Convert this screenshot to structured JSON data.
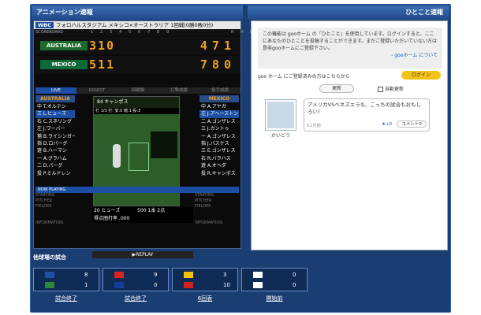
{
  "headers": {
    "animation": "アニメーション速報",
    "hitokoto": "ひとこと速報"
  },
  "game": {
    "tag": "WBC",
    "venue": "フォロハルスタジアム メキシコ×オーストラリア 1回戦(0勝0敗0分)",
    "score_header": [
      "SCOREBOARD",
      "1",
      "2",
      "3",
      "4",
      "5",
      "6",
      "7",
      "8",
      "9",
      "R",
      "H",
      "E"
    ],
    "away": {
      "name": "AUSTRALIA",
      "innings": "310",
      "rhe": "471"
    },
    "home": {
      "name": "MEXICO",
      "innings": "511",
      "rhe": "780"
    }
  },
  "tabs": [
    "LIVE",
    "DIGEST",
    "回顧録",
    "打撃成績",
    "投手成績"
  ],
  "left_team": {
    "name": "AUSTRALIA",
    "players": [
      "中 T.オルテン",
      "三 L.ヒューズ",
      "右 C.スネリング",
      "左 J.ワーバー",
      "捕 B.ライシンガー",
      "指 D.ロバーグ",
      "遊 B.ハーマン",
      "一 A.グラハム",
      "二 D.バーグ",
      "投 P.ミルドレン"
    ]
  },
  "right_team": {
    "name": "MEXICO",
    "players": [
      "中 A.アヤガ",
      "左 J.アヘーストン",
      "二 A.ゴンザレス",
      "三 J.カントゥ",
      "一 A.ゴンザレス",
      "指 J.パスケス",
      "三 E.ゴンザレス",
      "右 R.バラハス",
      "遊 A.オヘダ",
      "投 R.キャンポス"
    ]
  },
  "now_playing": "NOW PLAYING",
  "side_labels": [
    "STARTING",
    "PITCHER",
    "FIELDER",
    "INFORMATION"
  ],
  "play": {
    "pitcher": "84 キャンポス",
    "count": "打 1/3 打: 安:0 暗:1 投:3",
    "batter": "20 ヒューズ",
    "batter_stats": "500 1本 2点",
    "avg": "得点圏打率 .000",
    "replay": "▶REPLAY"
  },
  "others_title": "他球場の試合",
  "other_games": [
    {
      "a": "8",
      "b": "1",
      "status": "試合終了",
      "ca": "#1f4fa8",
      "cb": "#2a8a3a"
    },
    {
      "a": "9",
      "b": "0",
      "status": "試合終了",
      "ca": "#d22",
      "cb": "#123d9a"
    },
    {
      "a": "3",
      "b": "10",
      "status": "6回表",
      "ca": "#f2c200",
      "cb": "#c22"
    },
    {
      "a": "0",
      "b": "0",
      "status": "開始前",
      "ca": "#fff",
      "cb": "#fff"
    }
  ],
  "notice": {
    "text": "この機能は gooホーム の「ひとこと」を使用しています。ログインすると、ここにあなたのひとことを投稿することができます。まだご登録いただいていない方は是非gooホームにご登録下さい。",
    "link": "- gooホーム について"
  },
  "login": {
    "prompt": "goo ホーム にご登録済みの方はこちらから",
    "button": "ログイン",
    "update": "更新",
    "auto": "自動更新"
  },
  "post": {
    "user": "かいどう",
    "text": "アメリカVSベネズエラも、こっちの試合もおもしろい！",
    "time": "51分前",
    "stars": "★+0",
    "comment": "コメント0"
  }
}
